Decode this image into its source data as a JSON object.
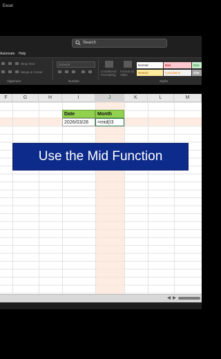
{
  "window": {
    "app_title": "Excel",
    "search_placeholder": "Search"
  },
  "menu": [
    "Automate",
    "Help"
  ],
  "ribbon": {
    "alignment": {
      "wrap_text": "Wrap Text",
      "merge_center": "Merge & Center",
      "group_label": "Alignment"
    },
    "number": {
      "format_value": "General",
      "group_label": "Number"
    },
    "styles": {
      "conditional_formatting": "Conditional Formatting",
      "format_as_table": "Format as Table",
      "normal": "Normal",
      "bad": "Bad",
      "good": "Goo",
      "neutral": "Neutral",
      "calculation": "Calculation",
      "check": "Che",
      "group_label": "Styles"
    }
  },
  "columns": [
    "F",
    "G",
    "H",
    "I",
    "J",
    "K",
    "L",
    "M"
  ],
  "cells": {
    "header_date": "Date",
    "header_month": "Month",
    "date_value": "2026/03/28",
    "formula_value": "=mid(I3"
  },
  "banner": {
    "text": "Use the Mid Function"
  },
  "colors": {
    "header_fill": "#92d050",
    "banner_fill": "#0d2b8a",
    "highlight": "#fce4d6",
    "active_border": "#217346"
  }
}
